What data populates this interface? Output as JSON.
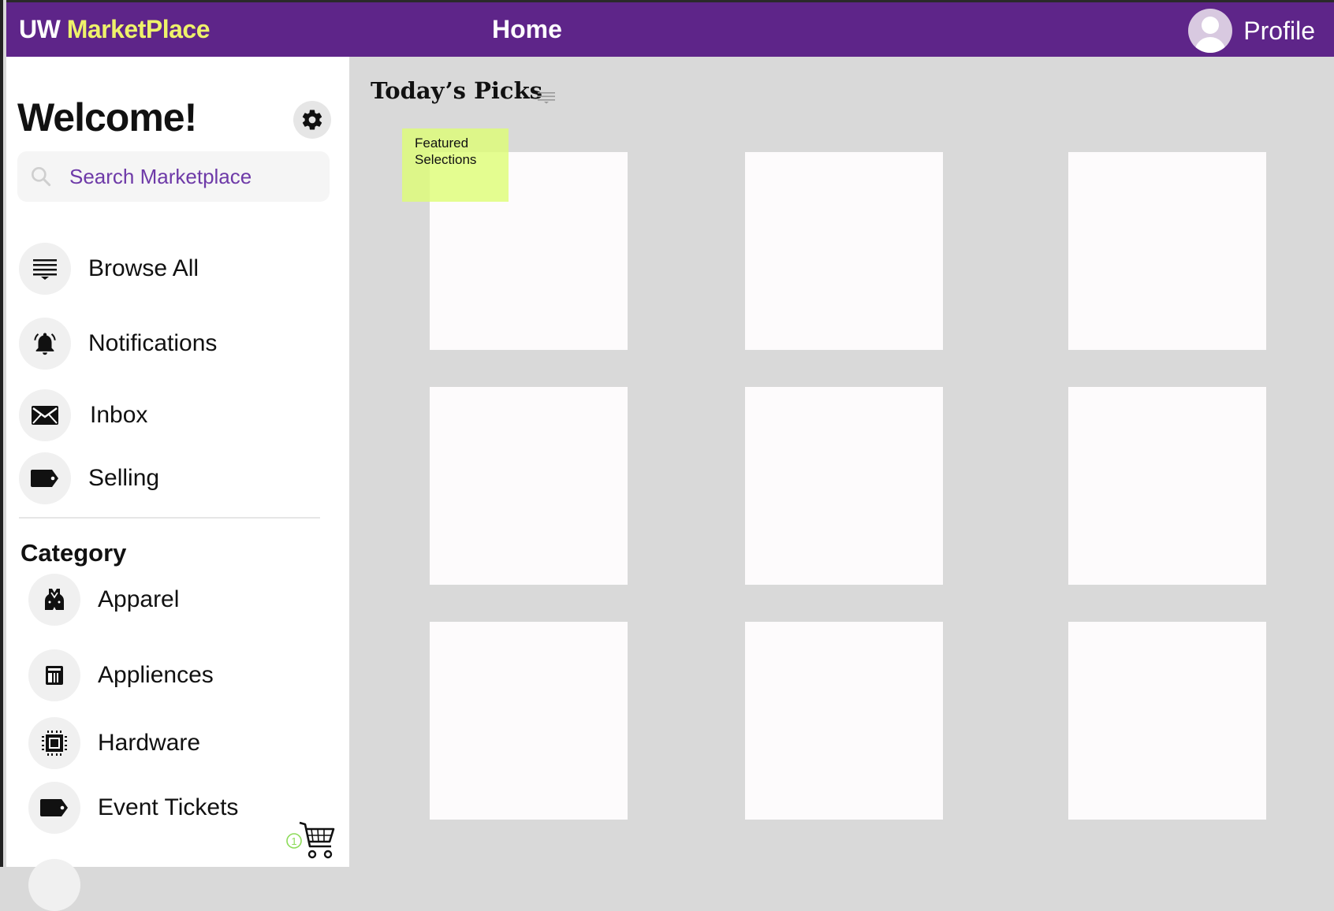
{
  "header": {
    "brand_prefix": "UW",
    "brand_accent": "MarketPlace",
    "home_label": "Home",
    "profile_label": "Profile"
  },
  "colors": {
    "header_bg": "#5e2589",
    "brand_accent": "#eef26a",
    "search_text": "#6e3aa8",
    "content_bg": "#d9d9d9",
    "sticky_note": "#e2fb8a",
    "cart_badge": "#8ddb5a"
  },
  "sidebar": {
    "welcome": "Welcome!",
    "settings_icon": "gear-icon",
    "search": {
      "placeholder": "Search Marketplace",
      "value": "",
      "icon": "search-icon"
    },
    "nav_items": [
      {
        "label": "Browse All",
        "icon": "filter-list-icon"
      },
      {
        "label": "Notifications",
        "icon": "bell-icon"
      },
      {
        "label": "Inbox",
        "icon": "envelope-icon"
      },
      {
        "label": "Selling",
        "icon": "tag-icon"
      }
    ],
    "category_heading": "Category",
    "categories": [
      {
        "label": "Apparel",
        "icon": "vest-icon"
      },
      {
        "label": "Appliences",
        "icon": "appliance-icon"
      },
      {
        "label": "Hardware",
        "icon": "chip-icon"
      },
      {
        "label": "Event Tickets",
        "icon": "tag-icon"
      }
    ],
    "cart": {
      "icon": "cart-icon",
      "count": "1"
    }
  },
  "main": {
    "title": "Today’s Picks",
    "title_menu_icon": "menu-lines-icon",
    "sticky_note": "Featured Selections"
  }
}
